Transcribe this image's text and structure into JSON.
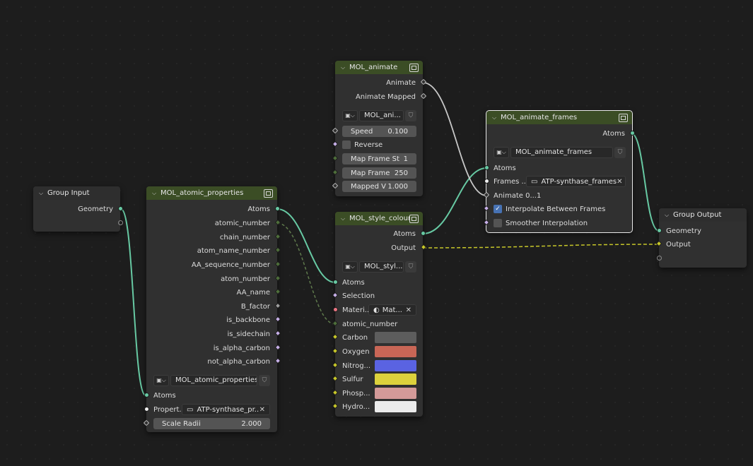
{
  "nodes": {
    "group_input": {
      "title": "Group Input",
      "outputs": [
        "Geometry"
      ]
    },
    "atomic_props": {
      "title": "MOL_atomic_properties",
      "outputs": [
        "Atoms",
        "atomic_number",
        "chain_number",
        "atom_name_number",
        "AA_sequence_number",
        "atom_number",
        "AA_name",
        "B_factor",
        "is_backbone",
        "is_sidechain",
        "is_alpha_carbon",
        "not_alpha_carbon"
      ],
      "group_name": "MOL_atomic_properties",
      "inputs": {
        "atoms": "Atoms",
        "property_label": "Propert...",
        "property_value": "ATP-synthase_pr...",
        "scale_label": "Scale Radii",
        "scale_value": "2.000"
      }
    },
    "animate": {
      "title": "MOL_animate",
      "outputs": [
        "Animate",
        "Animate Mapped"
      ],
      "group_name": "MOL_ani...",
      "fields": [
        {
          "label": "Speed",
          "value": "0.100"
        },
        {
          "label": "Reverse",
          "value": ""
        },
        {
          "label": "Map Frame St",
          "value": "1"
        },
        {
          "label": "Map Frame",
          "value": "250"
        },
        {
          "label": "Mapped V",
          "value": "1.000"
        }
      ]
    },
    "style_colour": {
      "title": "MOL_style_colour",
      "outputs": [
        "Atoms",
        "Output"
      ],
      "group_name": "MOL_styl...",
      "inputs": [
        "Atoms",
        "Selection",
        "Materi...",
        "atomic_number"
      ],
      "material_value": "Mat...",
      "colors": [
        {
          "label": "Carbon",
          "color": "#5d5d5d"
        },
        {
          "label": "Oxygen",
          "color": "#c96656"
        },
        {
          "label": "Nitrog...",
          "color": "#5a63e2"
        },
        {
          "label": "Sulfur",
          "color": "#dcd13c"
        },
        {
          "label": "Phosp...",
          "color": "#d49a99"
        },
        {
          "label": "Hydro...",
          "color": "#ececec"
        }
      ]
    },
    "animate_frames": {
      "title": "MOL_animate_frames",
      "outputs": [
        "Atoms"
      ],
      "group_name": "MOL_animate_frames",
      "inputs": [
        "Atoms",
        "Frames ...",
        "Animate 0...1",
        "Interpolate Between Frames",
        "Smoother Interpolation"
      ],
      "frames_value": "ATP-synthase_frames"
    },
    "group_output": {
      "title": "Group Output",
      "inputs": [
        "Geometry",
        "Output"
      ]
    }
  },
  "colors": {
    "geometry_link": "#67c9a3",
    "int_link": "#5f7a4c",
    "color_link": "#c7c729",
    "float_link": "#bdbdbd",
    "header_green": "#3b4d25"
  }
}
